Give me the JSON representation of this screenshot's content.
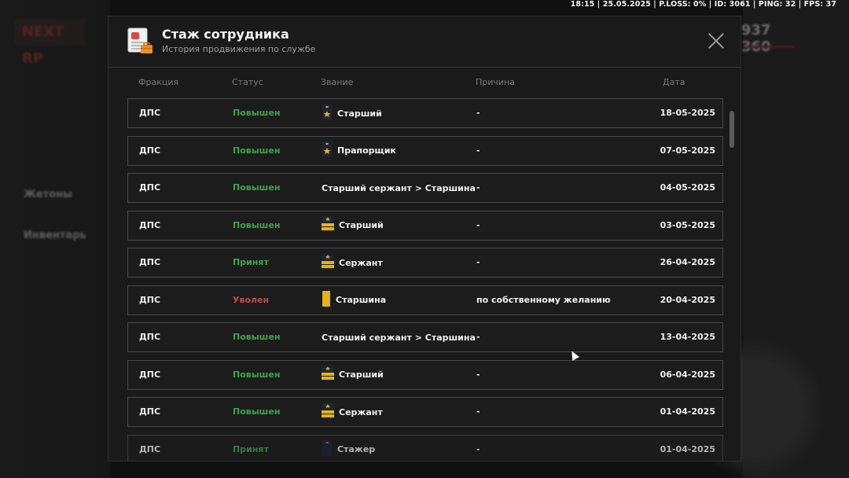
{
  "hud": {
    "text": "18:15 | 25.05.2025 | P.LOSS: 0% | ID: 3061 | PING: 32 | FPS: 37"
  },
  "background": {
    "logo": "NEXT RP",
    "money": "937 360",
    "labels": [
      "Жетоны",
      "Инвентарь"
    ]
  },
  "modal": {
    "title": "Стаж сотрудника",
    "subtitle": "История продвижения по службе",
    "close_icon": "close-icon",
    "columns": [
      "Фракция",
      "Статус",
      "Звание",
      "Причина",
      "Дата"
    ],
    "rows": [
      {
        "faction": "ДПС",
        "status": "Повышен",
        "status_type": "promoted",
        "rank": "Старший",
        "badge": "dark-star",
        "reason": "-",
        "date": "18-05-2025"
      },
      {
        "faction": "ДПС",
        "status": "Повышен",
        "status_type": "promoted",
        "rank": "Прапорщик",
        "badge": "dark-star",
        "reason": "-",
        "date": "07-05-2025"
      },
      {
        "faction": "ДПС",
        "status": "Повышен",
        "status_type": "promoted",
        "rank": "Старший сержант > Старшина",
        "badge": "",
        "reason": "-",
        "date": "04-05-2025"
      },
      {
        "faction": "ДПС",
        "status": "Повышен",
        "status_type": "promoted",
        "rank": "Старший",
        "badge": "gold-stripes",
        "reason": "-",
        "date": "03-05-2025"
      },
      {
        "faction": "ДПС",
        "status": "Принят",
        "status_type": "promoted",
        "rank": "Сержант",
        "badge": "gold-stripes",
        "reason": "-",
        "date": "26-04-2025"
      },
      {
        "faction": "ДПС",
        "status": "Уволен",
        "status_type": "fired",
        "rank": "Старшина",
        "badge": "gold-bar",
        "reason": "по собственному желанию",
        "date": "20-04-2025"
      },
      {
        "faction": "ДПС",
        "status": "Повышен",
        "status_type": "promoted",
        "rank": "Старший сержант > Старшина",
        "badge": "",
        "reason": "-",
        "date": "13-04-2025"
      },
      {
        "faction": "ДПС",
        "status": "Повышен",
        "status_type": "promoted",
        "rank": "Старший",
        "badge": "gold-stripes",
        "reason": "-",
        "date": "06-04-2025"
      },
      {
        "faction": "ДПС",
        "status": "Повышен",
        "status_type": "promoted",
        "rank": "Сержант",
        "badge": "gold-stripes",
        "reason": "-",
        "date": "01-04-2025"
      },
      {
        "faction": "ДПС",
        "status": "Принят",
        "status_type": "promoted",
        "rank": "Стажер",
        "badge": "dark-plain",
        "reason": "-",
        "date": "01-04-2025"
      }
    ]
  },
  "colors": {
    "promoted": "#3fa34a",
    "fired": "#c94a4a",
    "border": "#4a4a4a"
  }
}
